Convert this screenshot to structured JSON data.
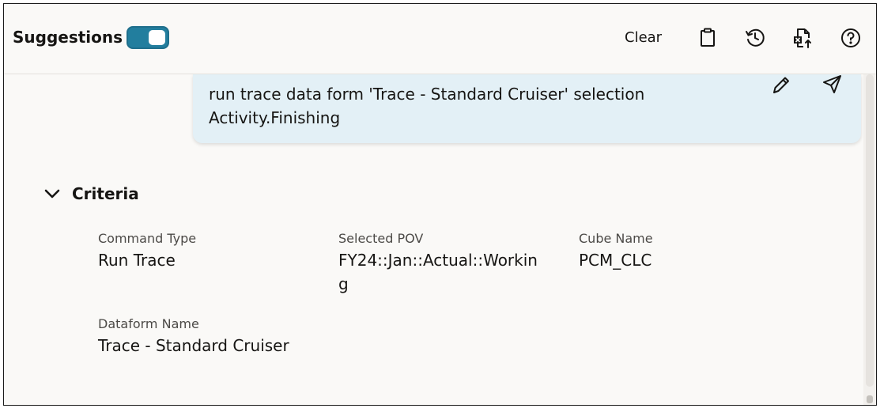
{
  "header": {
    "title": "Suggestions",
    "toggle_on": true,
    "clear_label": "Clear",
    "icons": [
      "clipboard-icon",
      "history-icon",
      "export-excel-icon",
      "help-icon"
    ]
  },
  "message": {
    "text": "run trace data form 'Trace - Standard Cruiser' selection Activity.Finishing",
    "icons": [
      "edit-icon",
      "send-icon"
    ]
  },
  "criteria": {
    "title": "Criteria",
    "expanded": true,
    "fields": [
      {
        "label": "Command Type",
        "value": "Run Trace"
      },
      {
        "label": "Selected POV",
        "value": "FY24::Jan::Actual::Working"
      },
      {
        "label": "Cube Name",
        "value": "PCM_CLC"
      },
      {
        "label": "Dataform Name",
        "value": "Trace - Standard Cruiser"
      }
    ]
  },
  "colors": {
    "accent": "#227e9e",
    "bubble": "#e3f0f6",
    "background": "#faf9f7"
  }
}
